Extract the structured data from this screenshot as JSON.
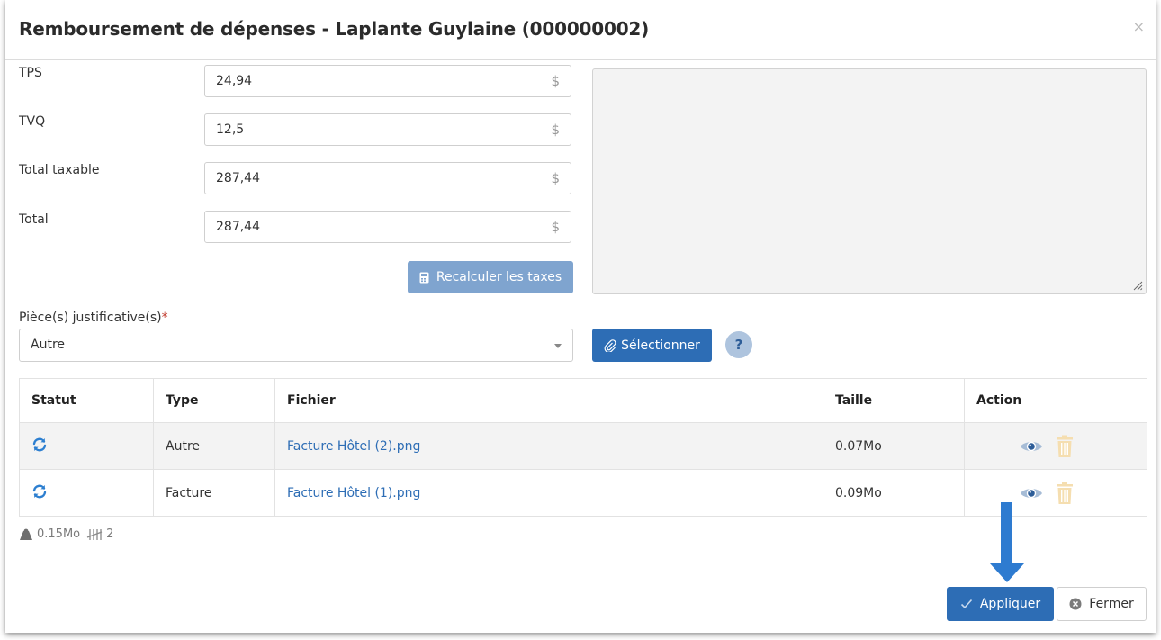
{
  "modal": {
    "title": "Remboursement de dépenses - Laplante Guylaine (000000002)",
    "close_glyph": "×"
  },
  "fields": [
    {
      "label": "TPS",
      "value": "24,94",
      "currency": "$"
    },
    {
      "label": "TVQ",
      "value": "12,5",
      "currency": "$"
    },
    {
      "label": "Total taxable",
      "value": "287,44",
      "currency": "$"
    },
    {
      "label": "Total",
      "value": "287,44",
      "currency": "$"
    }
  ],
  "recalc_button": {
    "label": "Recalculer les taxes",
    "icon": "calculator-icon"
  },
  "attachments": {
    "label": "Pièce(s) justificative(s)",
    "required_mark": "*",
    "selected": "Autre",
    "select_button": {
      "label": "Sélectionner",
      "icon": "paperclip-icon"
    },
    "help": "?"
  },
  "table": {
    "headers": [
      "Statut",
      "Type",
      "Fichier",
      "Taille",
      "Action"
    ],
    "rows": [
      {
        "status_icon": "sync-icon",
        "type": "Autre",
        "file": "Facture Hôtel (2).png",
        "size": "0.07Mo"
      },
      {
        "status_icon": "sync-icon",
        "type": "Facture",
        "file": "Facture Hôtel (1).png",
        "size": "0.09Mo"
      }
    ]
  },
  "summary": {
    "total_size": "0.15Mo",
    "count": "2"
  },
  "footer": {
    "apply_label": "Appliquer",
    "close_label": "Fermer"
  },
  "colors": {
    "primary": "#2d6db5",
    "primary_disabled": "#7fa4cf",
    "arrow": "#2e7bd0",
    "trash": "#f5deb0"
  }
}
